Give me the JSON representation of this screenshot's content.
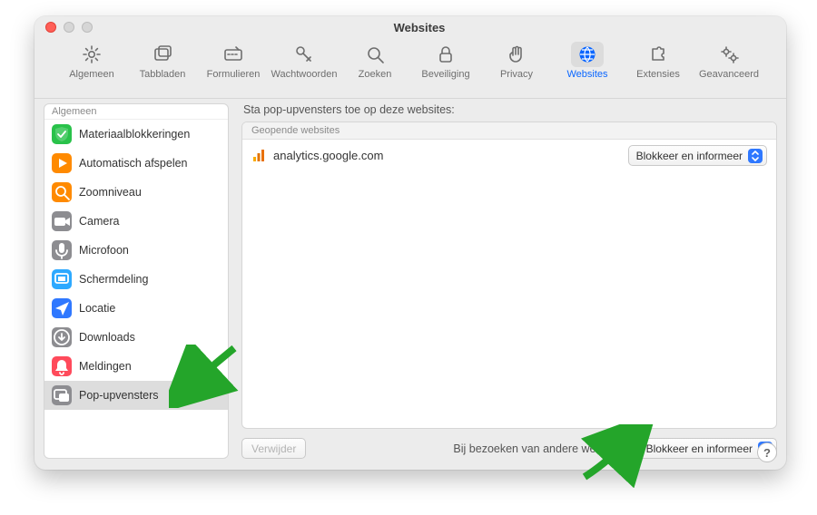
{
  "window": {
    "title": "Websites"
  },
  "toolbar": [
    {
      "id": "algemeen",
      "label": "Algemeen",
      "icon": "gear"
    },
    {
      "id": "tabbladen",
      "label": "Tabbladen",
      "icon": "tabs"
    },
    {
      "id": "formulieren",
      "label": "Formulieren",
      "icon": "form"
    },
    {
      "id": "wachtwoorden",
      "label": "Wachtwoorden",
      "icon": "key"
    },
    {
      "id": "zoeken",
      "label": "Zoeken",
      "icon": "search"
    },
    {
      "id": "beveiliging",
      "label": "Beveiliging",
      "icon": "lock"
    },
    {
      "id": "privacy",
      "label": "Privacy",
      "icon": "hand"
    },
    {
      "id": "websites",
      "label": "Websites",
      "icon": "globe",
      "active": true
    },
    {
      "id": "extensies",
      "label": "Extensies",
      "icon": "puzzle"
    },
    {
      "id": "geavanceerd",
      "label": "Geavanceerd",
      "icon": "gears"
    }
  ],
  "sidebar": {
    "group_label": "Algemeen",
    "items": [
      {
        "label": "Materiaalblokkeringen",
        "icon": "shield",
        "color": "#29c24a"
      },
      {
        "label": "Automatisch afspelen",
        "icon": "play",
        "color": "#ff8a00"
      },
      {
        "label": "Zoomniveau",
        "icon": "zoom",
        "color": "#ff8a00"
      },
      {
        "label": "Camera",
        "icon": "camera",
        "color": "#8d8d91"
      },
      {
        "label": "Microfoon",
        "icon": "mic",
        "color": "#8d8d91"
      },
      {
        "label": "Schermdeling",
        "icon": "screen",
        "color": "#2da9ff"
      },
      {
        "label": "Locatie",
        "icon": "loc",
        "color": "#2f78ff"
      },
      {
        "label": "Downloads",
        "icon": "down",
        "color": "#8d8d91"
      },
      {
        "label": "Meldingen",
        "icon": "bell",
        "color": "#ff4a5b"
      },
      {
        "label": "Pop-upvensters",
        "icon": "popup",
        "color": "#8d8d91",
        "selected": true
      }
    ]
  },
  "main": {
    "heading": "Sta pop-upvensters toe op deze websites:",
    "list_header": "Geopende websites",
    "rows": [
      {
        "domain": "analytics.google.com",
        "setting": "Blokkeer en informeer"
      }
    ],
    "delete_label": "Verwijder",
    "other_sites_label": "Bij bezoeken van andere websites:",
    "other_sites_setting": "Blokkeer en informeer",
    "help_glyph": "?"
  }
}
